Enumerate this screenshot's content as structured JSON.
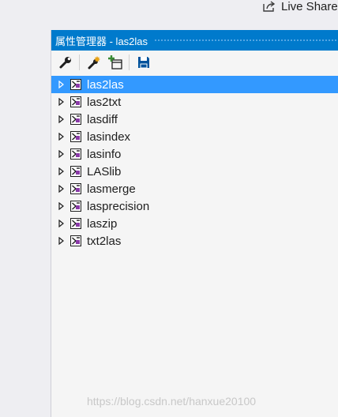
{
  "topbar": {
    "live_share_label": "Live Share"
  },
  "panel": {
    "title": "属性管理器 - las2las",
    "toolbar": {
      "buttons": [
        "properties-wrench-icon",
        "new-property-sheet-icon",
        "add-existing-property-sheet-icon",
        "save-icon"
      ]
    },
    "tree": {
      "items": [
        {
          "label": "las2las",
          "selected": true
        },
        {
          "label": "las2txt"
        },
        {
          "label": "lasdiff"
        },
        {
          "label": "lasindex"
        },
        {
          "label": "lasinfo"
        },
        {
          "label": "LASlib"
        },
        {
          "label": "lasmerge"
        },
        {
          "label": "lasprecision"
        },
        {
          "label": "laszip"
        },
        {
          "label": "txt2las"
        }
      ]
    }
  },
  "watermark": "https://blog.csdn.net/hanxue20100",
  "colors": {
    "accent": "#007acc",
    "selection": "#3399ff"
  }
}
